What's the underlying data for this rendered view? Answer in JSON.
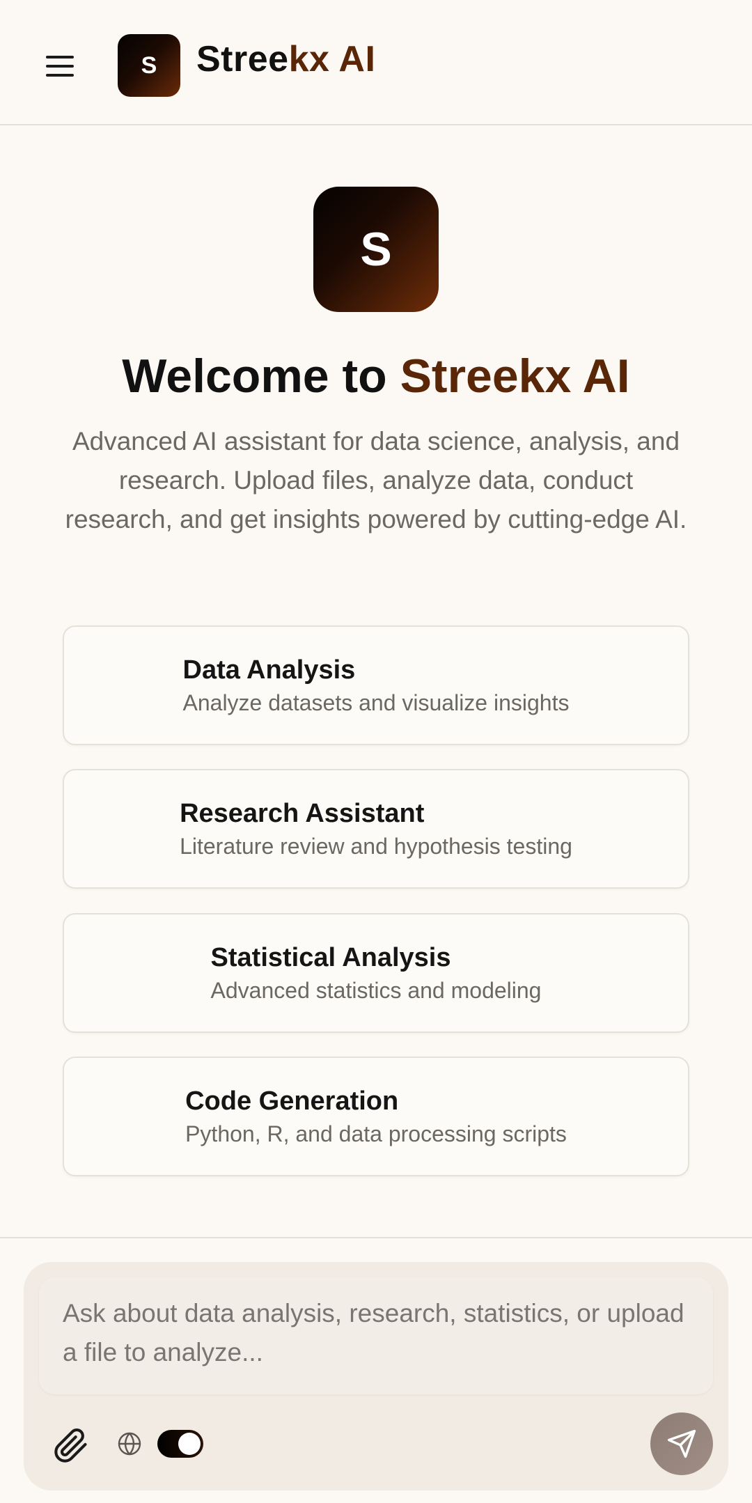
{
  "header": {
    "menu_icon": "hamburger-menu-icon",
    "logo_letter": "S",
    "brand_part1": "Stree",
    "brand_part2": "kx AI"
  },
  "hero": {
    "logo_letter": "S",
    "welcome_prefix": "Welcome to ",
    "welcome_brand": "Streekx AI",
    "subtitle": "Advanced AI assistant for data science, analysis, and research. Upload files, analyze data, conduct research, and get insights powered by cutting-edge AI."
  },
  "cards": [
    {
      "title": "Data Analysis",
      "description": "Analyze datasets and visualize insights"
    },
    {
      "title": "Research Assistant",
      "description": "Literature review and hypothesis testing"
    },
    {
      "title": "Statistical Analysis",
      "description": "Advanced statistics and modeling"
    },
    {
      "title": "Code Generation",
      "description": "Python, R, and data processing scripts"
    }
  ],
  "composer": {
    "placeholder": "Ask about data analysis, research, statistics, or upload a file to analyze...",
    "value": "",
    "attach_icon": "paperclip-icon",
    "web_icon": "globe-icon",
    "toggle_on": true,
    "send_icon": "send-icon"
  },
  "colors": {
    "background": "#fcf9f4",
    "accent": "#5a2608",
    "muted_text": "#6b6763",
    "composer_bg": "#f1ebe3"
  }
}
